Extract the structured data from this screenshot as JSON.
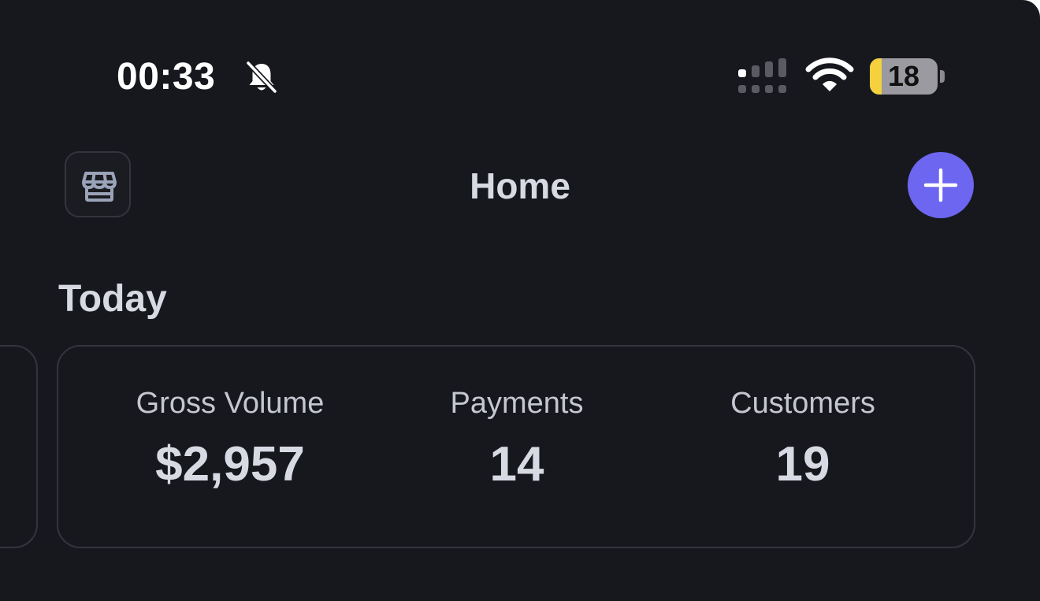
{
  "status_bar": {
    "time": "00:33",
    "battery_level": 18,
    "battery_level_text": "18",
    "icons": [
      "bell-slash-icon",
      "cellular-signal-icon",
      "wifi-icon",
      "battery-icon"
    ]
  },
  "nav": {
    "title": "Home",
    "left_icon": "storefront-icon",
    "right_icon": "plus-icon"
  },
  "today": {
    "title": "Today",
    "stats": [
      {
        "label": "Gross Volume",
        "value": "$2,957"
      },
      {
        "label": "Payments",
        "value": "14"
      },
      {
        "label": "Customers",
        "value": "19"
      }
    ]
  },
  "colors": {
    "background": "#17181e",
    "accent": "#6d66f0",
    "battery_fill": "#f5d13d",
    "card_border": "#33353d"
  }
}
